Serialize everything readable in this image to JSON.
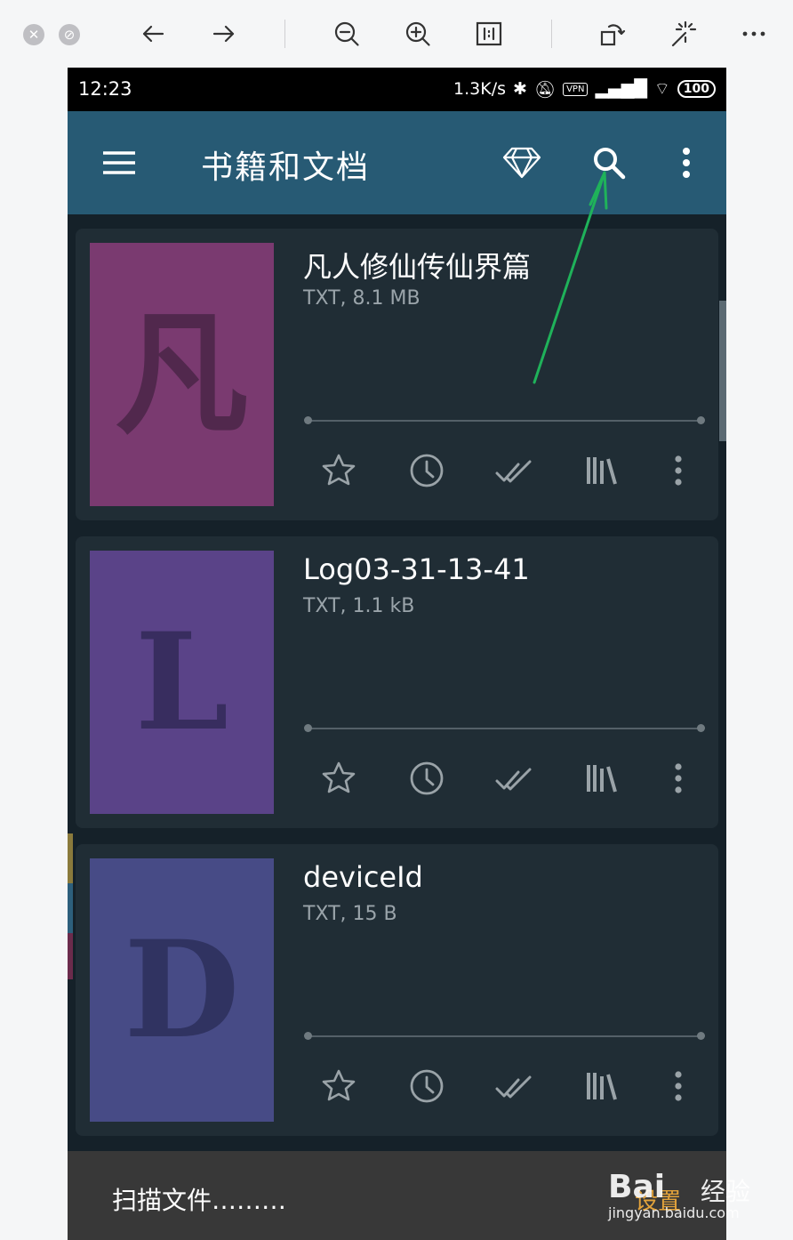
{
  "status_bar": {
    "time": "12:23",
    "net_speed": "1.3K/s",
    "vpn_label": "VPN",
    "battery": "100"
  },
  "app_bar": {
    "title": "书籍和文档",
    "icons": [
      "menu-icon",
      "diamond-icon",
      "search-icon",
      "more-vert-icon"
    ]
  },
  "books": [
    {
      "title": "凡人修仙传仙界篇",
      "meta": "TXT, 8.1 MB",
      "cover_letter": "凡",
      "cover_color": "#7a3a70"
    },
    {
      "title": "Log03-31-13-41",
      "meta": "TXT, 1.1 kB",
      "cover_letter": "L",
      "cover_color": "#5a4388"
    },
    {
      "title": "deviceId",
      "meta": "TXT, 15 B",
      "cover_letter": "D",
      "cover_color": "#474b86"
    }
  ],
  "card_actions": [
    "star-icon",
    "clock-icon",
    "double-check-icon",
    "library-icon",
    "more-vert-icon"
  ],
  "bottom_bar": {
    "scan_text": "扫描文件………",
    "settings_text": "设置"
  },
  "watermark": {
    "logo": "Bai",
    "text": "经验",
    "url": "jingyan.baidu.com"
  },
  "colors": {
    "app_bar": "#275a74",
    "list_bg": "#152129",
    "card_bg": "#202d35",
    "annotation_arrow": "#1fb25a",
    "settings_accent": "#e3a33b"
  }
}
